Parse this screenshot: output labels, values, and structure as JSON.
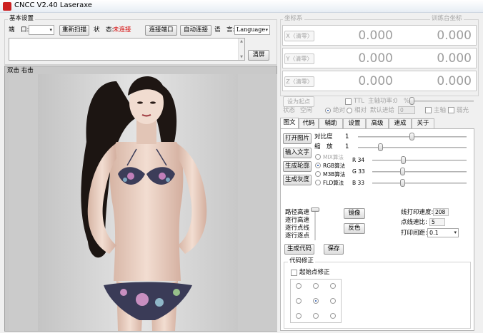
{
  "window": {
    "title": "CNCC V2.40  Laseraxe"
  },
  "basic": {
    "group_title": "基本设置",
    "port_label": "端　口:",
    "port_value": "",
    "rescan": "重新扫描",
    "status_label": "状　态:",
    "status_value": "未连接",
    "connect": "连接端口",
    "autoconnect": "自动连接",
    "lang_label": "语　言:",
    "lang_value": "Language",
    "clear": "清屏"
  },
  "canvas": {
    "hint": "双击 右击"
  },
  "coords": {
    "group_title": "坐标系",
    "header_right": "训练台坐标",
    "rows": [
      {
        "label": "X〈清零〉",
        "value": "0.000",
        "value2": "0.000"
      },
      {
        "label": "Y〈清零〉",
        "value": "0.000",
        "value2": "0.000"
      },
      {
        "label": "Z〈清零〉",
        "value": "0.000",
        "value2": "0.000"
      }
    ],
    "set_origin": "设为起点",
    "ttl": "TTL",
    "laser_power_label": "主轴功率:",
    "laser_power_value": "0",
    "laser_power_unit": "%",
    "state_label": "状态",
    "state_value": "空闲",
    "absolute": "绝对",
    "relative": "相对",
    "default_pos_label": "默认进给",
    "default_pos_value": "0",
    "spindle": "主轴",
    "weak_light": "弱光"
  },
  "tabs": [
    "图文",
    "代码",
    "辅助",
    "设置",
    "高级",
    "速成",
    "关于"
  ],
  "image_tab": {
    "open_image": "打开图片",
    "input_text": "输入文字",
    "gen_outline": "生成轮廓",
    "gen_gray": "生成灰度",
    "contrast_label": "对比度",
    "contrast_value": "1",
    "scale_label": "缩　放",
    "scale_value": "1",
    "algos": [
      "MIX算法",
      "RGB算法",
      "M3B算法",
      "FLD算法"
    ],
    "r_label": "R  34",
    "g_label": "G  33",
    "b_label": "B  33",
    "r_level": 0.34,
    "g_level": 0.33,
    "b_level": 0.33,
    "path_modes": [
      "路径高速",
      "逐行高速",
      "逐行点线",
      "逐行逐点"
    ],
    "mirror": "镜像",
    "invert": "反色",
    "line_speed_label": "线打印速度:",
    "line_speed_value": "208",
    "dot_delay_label": "点线速比:",
    "dot_delay_value": "5",
    "print_gap_label": "打印间距:",
    "print_gap_value": "0.1",
    "gen_code": "生成代码",
    "save": "保存",
    "correction_title": "代码修正",
    "origin_correction": "起始点修正"
  }
}
